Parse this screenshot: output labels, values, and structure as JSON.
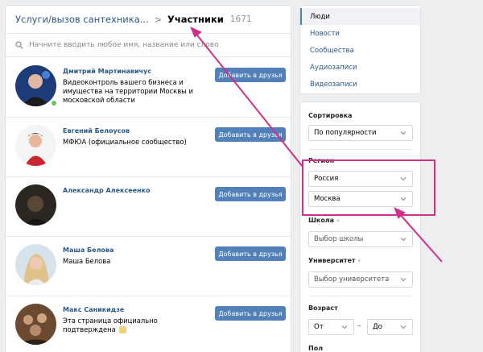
{
  "breadcrumb": {
    "group": "Услуги/вызов сантехника...",
    "separator": ">",
    "current": "Участники",
    "count": "1671"
  },
  "search": {
    "placeholder": "Начните вводить любое имя, название или слово"
  },
  "people": [
    {
      "name": "Дмитрий Мартинавичус",
      "description": "Видеоконтроль вашего бизнеса и имущества на территории Москвы и московской области",
      "button": "Добавить в друзья",
      "online": true
    },
    {
      "name": "Евгений Белоусов",
      "description": "МФЮА (официальное сообщество)",
      "button": "Добавить в друзья",
      "online": false
    },
    {
      "name": "Александр Алексеенко",
      "description": "",
      "button": "Добавить в друзья",
      "online": false
    },
    {
      "name": "Маша Белова",
      "description": "Маша Белова",
      "button": "Добавить в друзья",
      "online": false
    },
    {
      "name": "Макс Саникидзе",
      "description": "Эта страница официально подтверждена",
      "button": "Добавить в друзья",
      "online": false
    }
  ],
  "menu": {
    "items": [
      "Люди",
      "Новости",
      "Сообщества",
      "Аудиозаписи",
      "Видеозаписи"
    ],
    "active": "Люди"
  },
  "filters": {
    "sort_label": "Сортировка",
    "sort_value": "По популярности",
    "region_label": "Регион",
    "country": "Россия",
    "city": "Москва",
    "school_label": "Школа",
    "school_value": "Выбор школы",
    "university_label": "Университет",
    "university_value": "Выбор университета",
    "age_label": "Возраст",
    "age_from": "От",
    "age_dash": "–",
    "age_to": "До",
    "gender_label": "Пол"
  },
  "colors": {
    "link": "#2a5885",
    "button": "#5181b8",
    "annotation": "#d0308a",
    "online": "#6fc05a"
  }
}
